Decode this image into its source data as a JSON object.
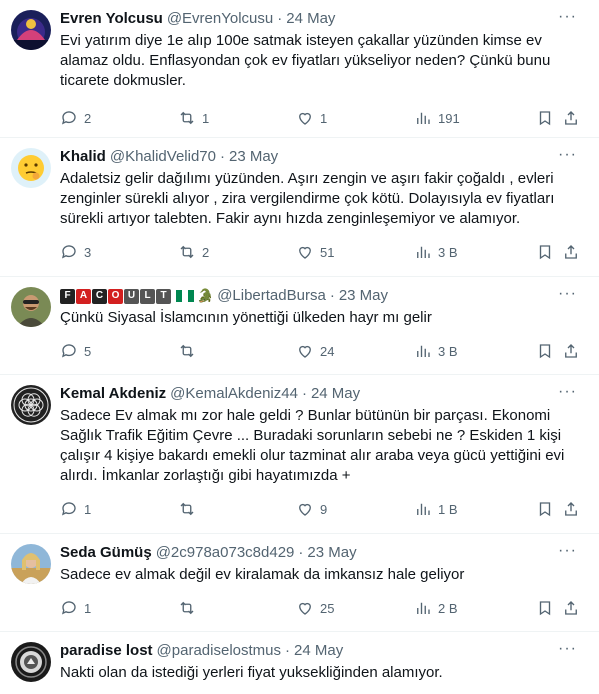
{
  "colors": {
    "text": "#0f1419",
    "muted": "#536471",
    "divider": "#eff3f4"
  },
  "tweets": [
    {
      "name": "Evren Yolcusu",
      "handle": "@EvrenYolcusu",
      "date": "24 May",
      "body": "Evi yatırım diye 1e  alıp 100e satmak isteyen çakallar yüzünden kimse ev alamaz oldu. Enflasyondan çok ev fiyatları yükseliyor neden? Çünkü bunu ticarete dokmusler.",
      "replies": "2",
      "retweets": "1",
      "likes": "1",
      "views": "191"
    },
    {
      "name": "Khalid",
      "handle": "@KhalidVelid70",
      "date": "23 May",
      "body": "Adaletsiz gelir dağılımı yüzünden. Aşırı zengin ve aşırı fakir çoğaldı , evleri zenginler sürekli alıyor , zira vergilendirme çok kötü. Dolayısıyla ev fiyatları sürekli artıyor talebten. Fakir aynı hızda zenginleşemiyor ve alamıyor.",
      "replies": "3",
      "retweets": "2",
      "likes": "51",
      "views": "3 B"
    },
    {
      "name_chips": [
        "F",
        "A",
        "C",
        "O",
        "U",
        "L",
        "T"
      ],
      "emoji": "🐊",
      "handle": "@LibertadBursa",
      "date": "23 May",
      "body": "Çünkü Siyasal İslamcının yönettiği ülkeden hayr mı gelir",
      "replies": "5",
      "retweets": "",
      "likes": "24",
      "views": "3 B"
    },
    {
      "name": "Kemal Akdeniz",
      "handle": "@KemalAkdeniz44",
      "date": "24 May",
      "body": "Sadece Ev almak mı zor hale geldi ? Bunlar bütünün bir parçası. Ekonomi Sağlık Trafik Eğitim Çevre  ... Buradaki sorunların sebebi ne ? Eskiden 1 kişi çalışır 4 kişiye bakardı emekli olur tazminat alır araba veya  gücü yettiğini evi  alırdı. İmkanlar  zorlaştığı gibi hayatımızda +",
      "replies": "1",
      "retweets": "",
      "likes": "9",
      "views": "1 B"
    },
    {
      "name": "Seda Gümüş",
      "handle": "@2c978a073c8d429",
      "date": "23 May",
      "body": "Sadece ev almak değil ev kiralamak da imkansız hale geliyor",
      "replies": "1",
      "retweets": "",
      "likes": "25",
      "views": "2 B"
    },
    {
      "name": "paradise lost",
      "handle": "@paradiselostmus",
      "date": "24 May",
      "body": "Nakti olan da istediği yerleri fiyat yuksekliğinden alamıyor.",
      "replies": "",
      "retweets": "",
      "likes": "",
      "views": ""
    }
  ]
}
